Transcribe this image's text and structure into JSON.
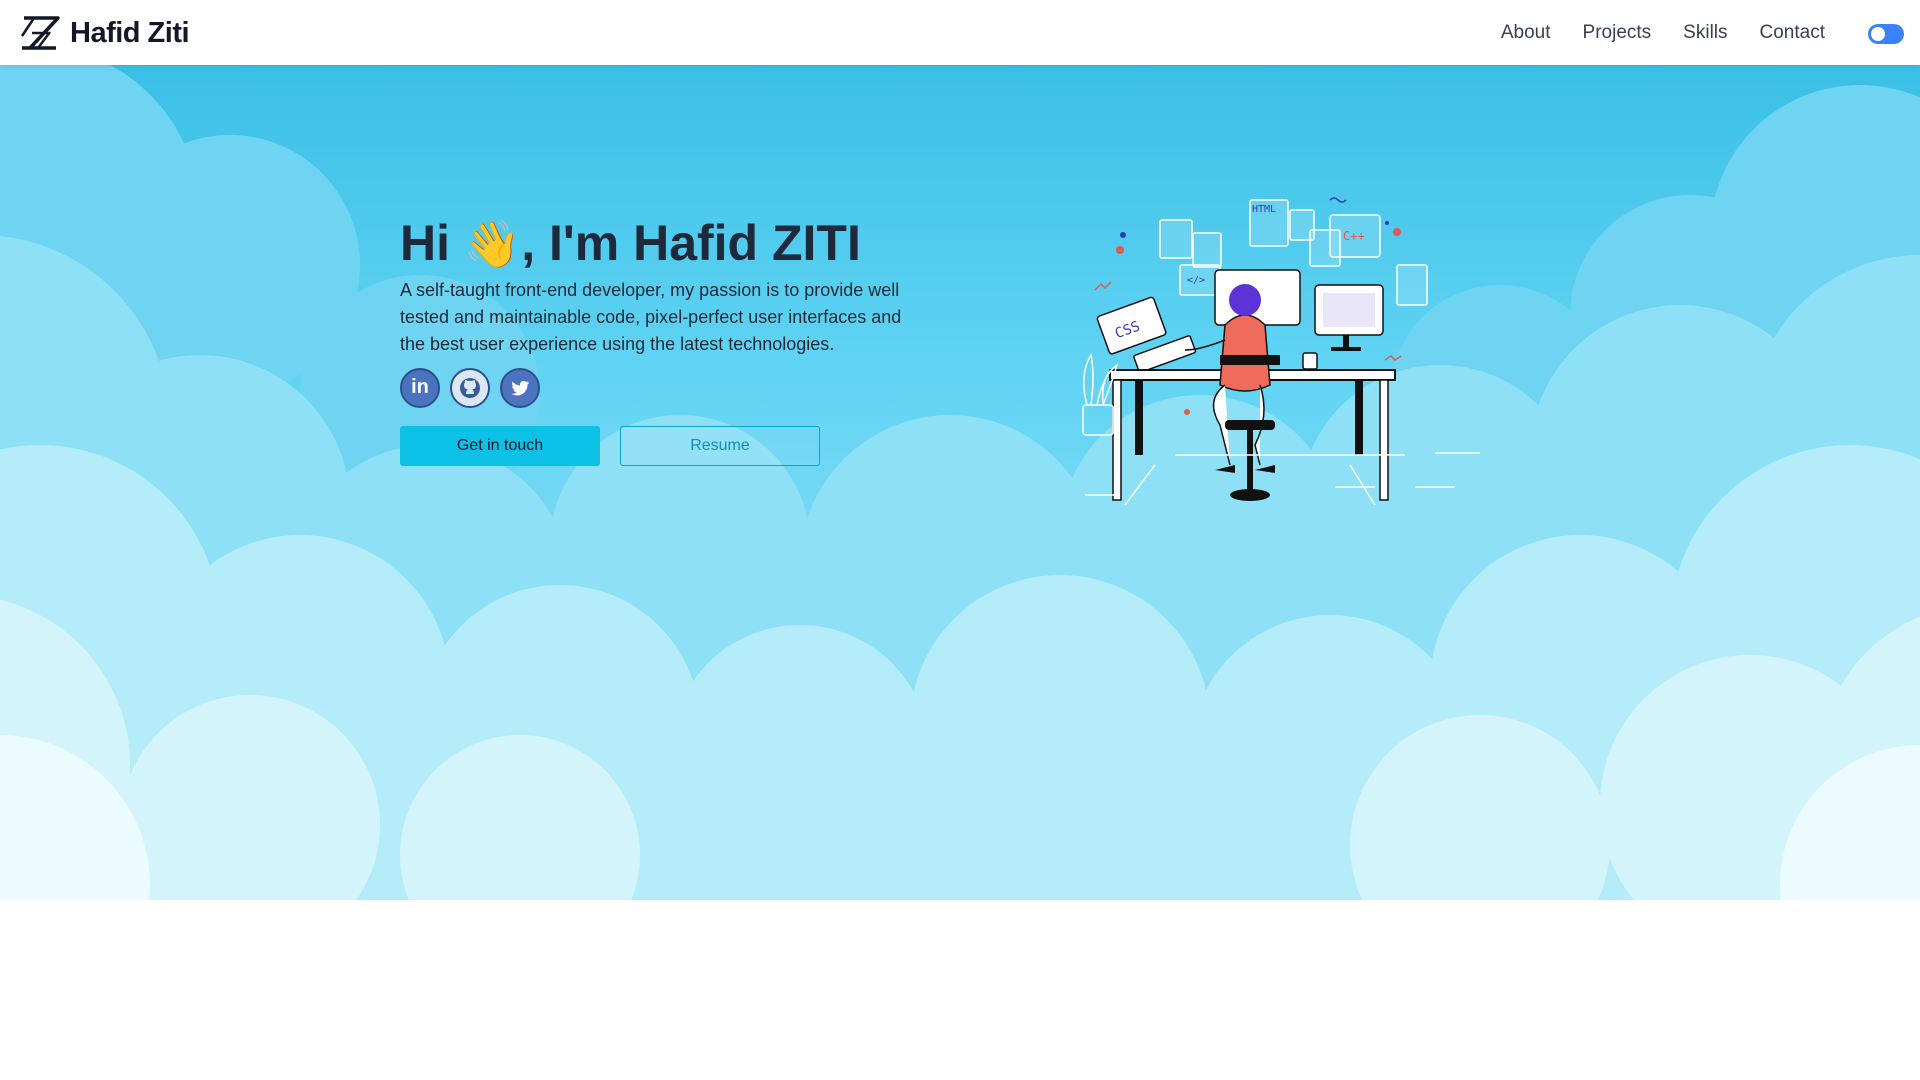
{
  "header": {
    "logo_text": "Hafid Ziti",
    "nav": [
      "About",
      "Projects",
      "Skills",
      "Contact"
    ],
    "theme_toggle_icon": "toggle-switch-icon"
  },
  "hero": {
    "greeting_start": "Hi",
    "wave_emoji": "👋",
    "greeting_end": ", I'm Hafid ZITI",
    "description": "A self-taught front-end developer, my passion is to provide well tested and maintainable code, pixel-perfect user interfaces and the best user experience using the latest technologies.",
    "socials": [
      {
        "name": "linkedin-icon",
        "label": "in"
      },
      {
        "name": "github-icon",
        "label": ""
      },
      {
        "name": "twitter-icon",
        "label": ""
      }
    ],
    "buttons": {
      "primary": "Get in touch",
      "secondary": "Resume"
    }
  },
  "illustration": {
    "laptop_label": "CSS",
    "doc_labels": [
      "HTML",
      "C++",
      "</>"
    ]
  },
  "colors": {
    "sky_top": "#3fc6ec",
    "cloud_light": "#e8f9fd",
    "accent": "#0cc0e6",
    "toggle": "#3b82f6"
  }
}
